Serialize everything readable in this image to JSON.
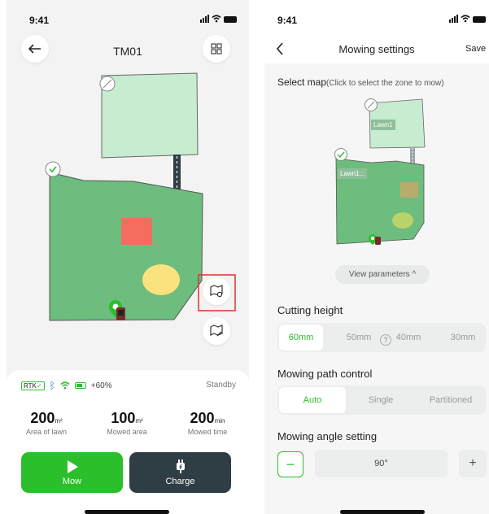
{
  "left": {
    "status_time": "9:41",
    "title": "TM01",
    "rtk_label": "RTK",
    "battery_label": "+60%",
    "state": "Standby",
    "stats": [
      {
        "value": "200",
        "unit": "m²",
        "label": "Area of lawn"
      },
      {
        "value": "100",
        "unit": "m²",
        "label": "Mowed area"
      },
      {
        "value": "200",
        "unit": "min",
        "label": "Mowed time"
      }
    ],
    "mow_label": "Mow",
    "charge_label": "Charge"
  },
  "right": {
    "status_time": "9:41",
    "title": "Mowing settings",
    "save_label": "Save",
    "select_map_label": "Select map",
    "select_map_hint": "(Click to select the zone to mow)",
    "zone1_label": "Lawn1",
    "zone2_label": "Lawn1...",
    "view_params_label": "View parameters ^",
    "cutting_height_title": "Cutting height",
    "cutting_heights": [
      "60mm",
      "50mm",
      "40mm",
      "30mm"
    ],
    "help_glyph": "?",
    "path_control_title": "Mowing path control",
    "path_options": [
      "Auto",
      "Single",
      "Partitioned"
    ],
    "angle_title": "Mowing angle setting",
    "angle_value": "90°",
    "minus_label": "−",
    "plus_label": "+"
  },
  "colors": {
    "accent_green": "#2bbf2b",
    "lawn_dark": "#6cbd7e",
    "lawn_light": "#c8ecd0",
    "obstacle_red": "#f46d5e",
    "obstacle_yellow": "#fae27f",
    "charge_dark": "#2f3d44",
    "highlight_red": "#e0312b"
  }
}
